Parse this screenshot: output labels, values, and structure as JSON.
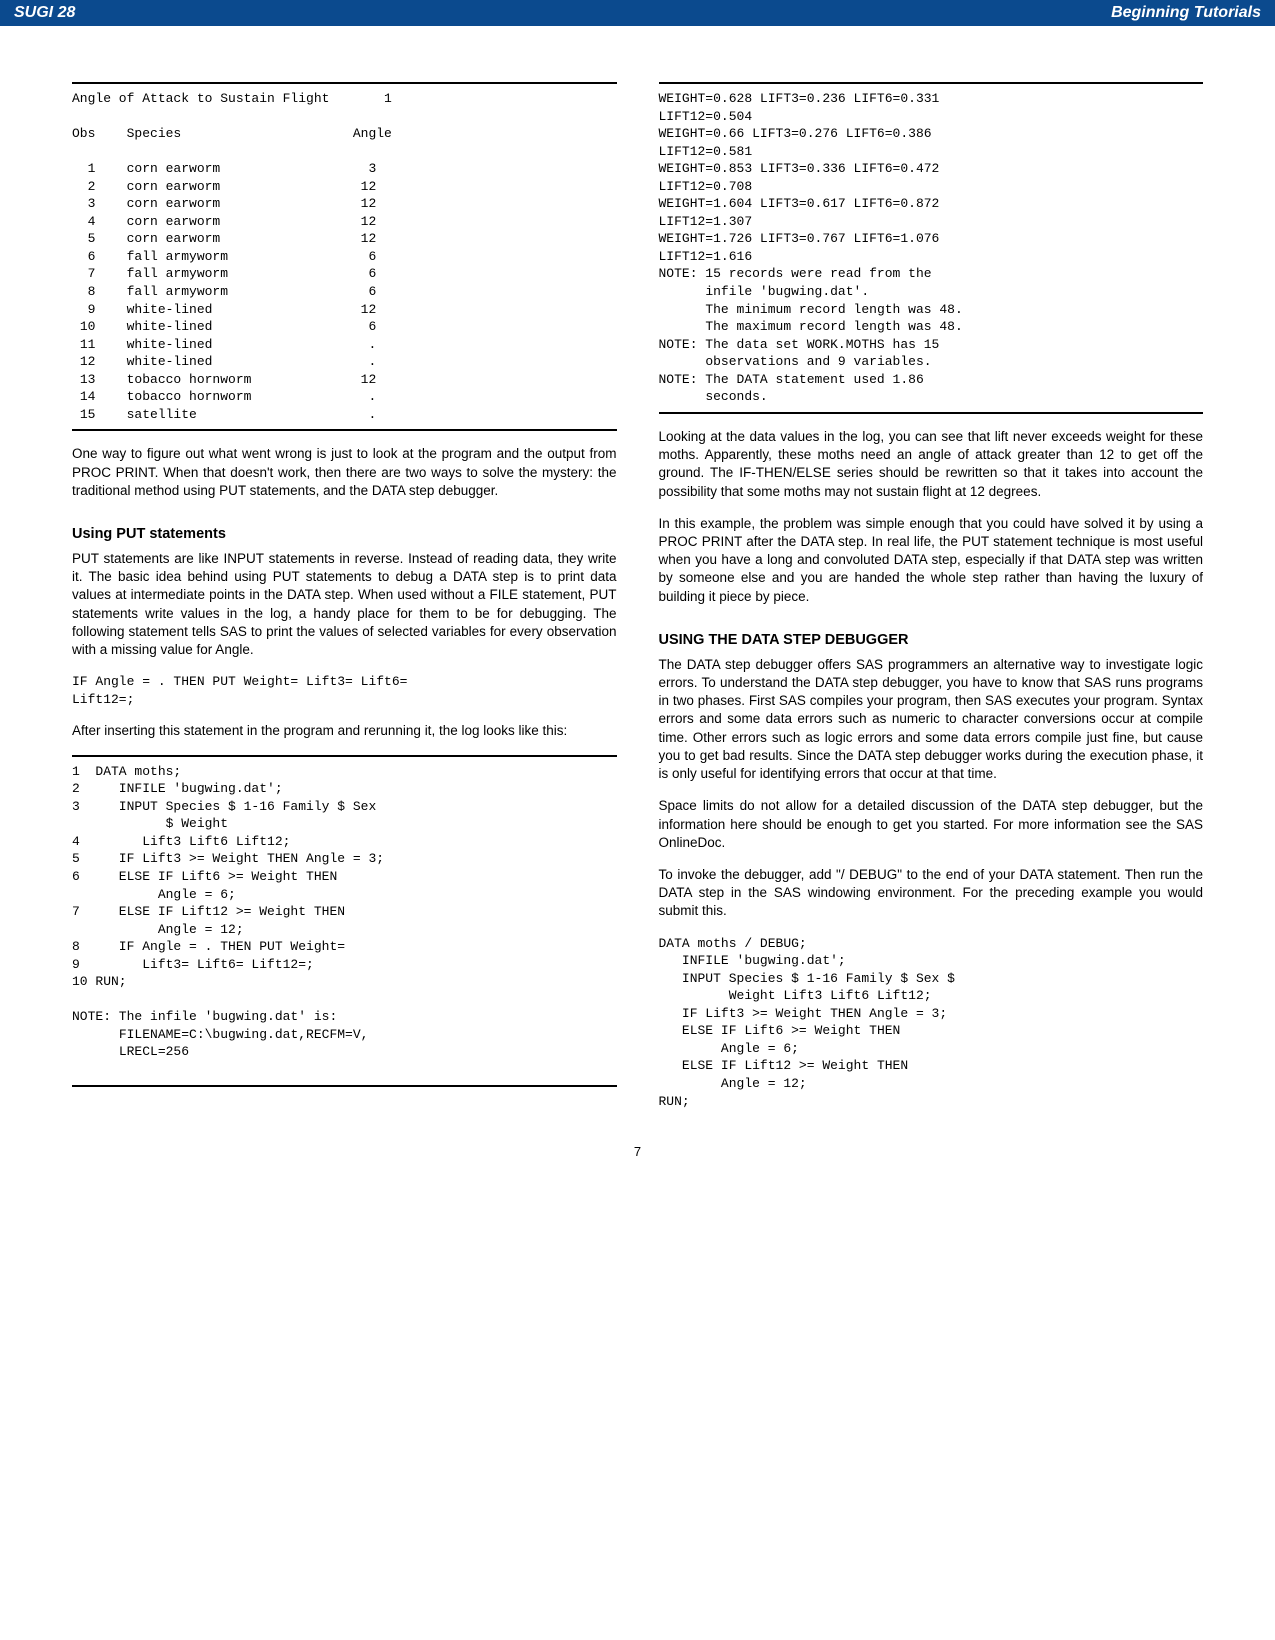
{
  "header": {
    "left": "SUGI 28",
    "right": "Beginning Tutorials"
  },
  "col_left": {
    "box1": "Angle of Attack to Sustain Flight       1\n\nObs    Species                      Angle\n\n  1    corn earworm                   3\n  2    corn earworm                  12\n  3    corn earworm                  12\n  4    corn earworm                  12\n  5    corn earworm                  12\n  6    fall armyworm                  6\n  7    fall armyworm                  6\n  8    fall armyworm                  6\n  9    white-lined                   12\n 10    white-lined                    6\n 11    white-lined                    .\n 12    white-lined                    .\n 13    tobacco hornworm              12\n 14    tobacco hornworm               .\n 15    satellite                      .",
    "p1": "One way to figure out what went wrong is just to look at the program and the output from PROC PRINT.  When that doesn't work, then there are two ways to solve the mystery: the traditional method using PUT statements, and the DATA step debugger.",
    "h1": "Using PUT statements",
    "p2": "PUT statements are like INPUT statements in reverse.  Instead of reading data, they write it.  The basic idea behind using PUT statements to debug a DATA step is to print data values at intermediate points in the DATA step.  When used without a FILE statement, PUT statements write values in the log, a handy place for them to be for debugging.  The following statement tells SAS to print the values of selected variables for every observation with a missing value for Angle.",
    "code1": "IF Angle = . THEN PUT Weight= Lift3= Lift6=\nLift12=;",
    "p3": "After inserting this statement in the program and rerunning it, the log looks like this:",
    "box2": "1  DATA moths;\n2     INFILE 'bugwing.dat';\n3     INPUT Species $ 1-16 Family $ Sex\n            $ Weight\n4        Lift3 Lift6 Lift12;\n5     IF Lift3 >= Weight THEN Angle = 3;\n6     ELSE IF Lift6 >= Weight THEN\n           Angle = 6;\n7     ELSE IF Lift12 >= Weight THEN\n           Angle = 12;\n8     IF Angle = . THEN PUT Weight=\n9        Lift3= Lift6= Lift12=;\n10 RUN;\n\nNOTE: The infile 'bugwing.dat' is:\n      FILENAME=C:\\bugwing.dat,RECFM=V,\n      LRECL=256\n "
  },
  "col_right": {
    "box1": "WEIGHT=0.628 LIFT3=0.236 LIFT6=0.331\nLIFT12=0.504\nWEIGHT=0.66 LIFT3=0.276 LIFT6=0.386\nLIFT12=0.581\nWEIGHT=0.853 LIFT3=0.336 LIFT6=0.472\nLIFT12=0.708\nWEIGHT=1.604 LIFT3=0.617 LIFT6=0.872\nLIFT12=1.307\nWEIGHT=1.726 LIFT3=0.767 LIFT6=1.076\nLIFT12=1.616\nNOTE: 15 records were read from the\n      infile 'bugwing.dat'.\n      The minimum record length was 48.\n      The maximum record length was 48.\nNOTE: The data set WORK.MOTHS has 15\n      observations and 9 variables.\nNOTE: The DATA statement used 1.86\n      seconds.",
    "p1": "Looking at the data values in the log, you can see that lift never exceeds weight for these moths.  Apparently, these moths need an angle of attack greater than 12 to get off the ground.  The IF-THEN/ELSE series should be rewritten so that it takes into account the possibility that some moths may not sustain flight at 12 degrees.",
    "p2": "In this example, the problem was simple enough that you could have solved it by using a PROC PRINT after the DATA step.  In real life, the PUT statement technique is most useful when you have a long and convoluted DATA step, especially if that DATA step was written by someone else and you are handed the whole step rather than having the luxury of building it piece by piece.",
    "h1": "USING THE DATA STEP DEBUGGER",
    "p3": "The DATA step debugger offers SAS programmers an alternative way to investigate logic errors.  To understand the DATA step debugger, you have to know that SAS runs programs in two phases.  First SAS compiles your program, then SAS executes your program.  Syntax errors and some data errors such as numeric to character conversions occur at compile time.  Other errors such as logic errors and some data errors compile just fine, but cause you to get bad results.  Since the DATA step debugger works during the execution phase, it is only useful for identifying errors that occur at that time.",
    "p4": "Space limits do not allow for a detailed discussion of the DATA step debugger, but the information here should be enough to get you started.  For more information see the SAS OnlineDoc.",
    "p5": "To invoke the debugger, add \"/ DEBUG\" to the end of your DATA statement.  Then run the DATA step in the SAS windowing environment.  For the preceding example you would submit this.",
    "code1": "DATA moths / DEBUG;\n   INFILE 'bugwing.dat';\n   INPUT Species $ 1-16 Family $ Sex $\n         Weight Lift3 Lift6 Lift12;\n   IF Lift3 >= Weight THEN Angle = 3;\n   ELSE IF Lift6 >= Weight THEN\n        Angle = 6;\n   ELSE IF Lift12 >= Weight THEN\n        Angle = 12;\nRUN;"
  },
  "pageno": "7"
}
